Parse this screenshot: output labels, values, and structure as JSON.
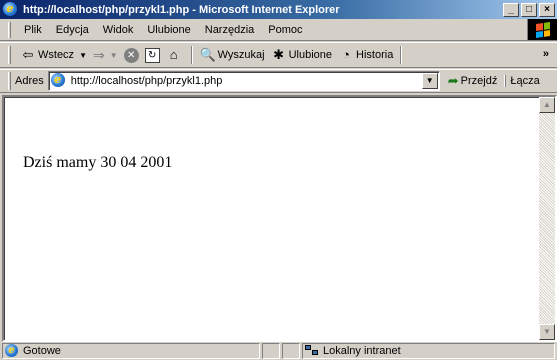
{
  "window": {
    "title": "http://localhost/php/przykl1.php - Microsoft Internet Explorer",
    "buttons": {
      "minimize": "_",
      "maximize": "□",
      "close": "×"
    }
  },
  "menu": {
    "items": [
      {
        "label": "Plik",
        "accesskey": "P"
      },
      {
        "label": "Edycja",
        "accesskey": "E"
      },
      {
        "label": "Widok",
        "accesskey": "W"
      },
      {
        "label": "Ulubione",
        "accesskey": "b"
      },
      {
        "label": "Narzędzia",
        "accesskey": "N"
      },
      {
        "label": "Pomoc",
        "accesskey": "c"
      }
    ]
  },
  "toolbar": {
    "back_label": "Wstecz",
    "search_label": "Wyszukaj",
    "favorites_label": "Ulubione",
    "history_label": "Historia",
    "more": "»"
  },
  "address": {
    "label": "Adres",
    "url": "http://localhost/php/przykl1.php",
    "go_label": "Przejdź",
    "links_label": "Łącza"
  },
  "page": {
    "text": "Dziś mamy 30 04 2001"
  },
  "status": {
    "text": "Gotowe",
    "zone": "Lokalny intranet"
  },
  "colors": {
    "title_start": "#0a246a",
    "title_end": "#a6caf0",
    "chrome": "#d4d0c8",
    "content_bg": "#ffffff"
  }
}
